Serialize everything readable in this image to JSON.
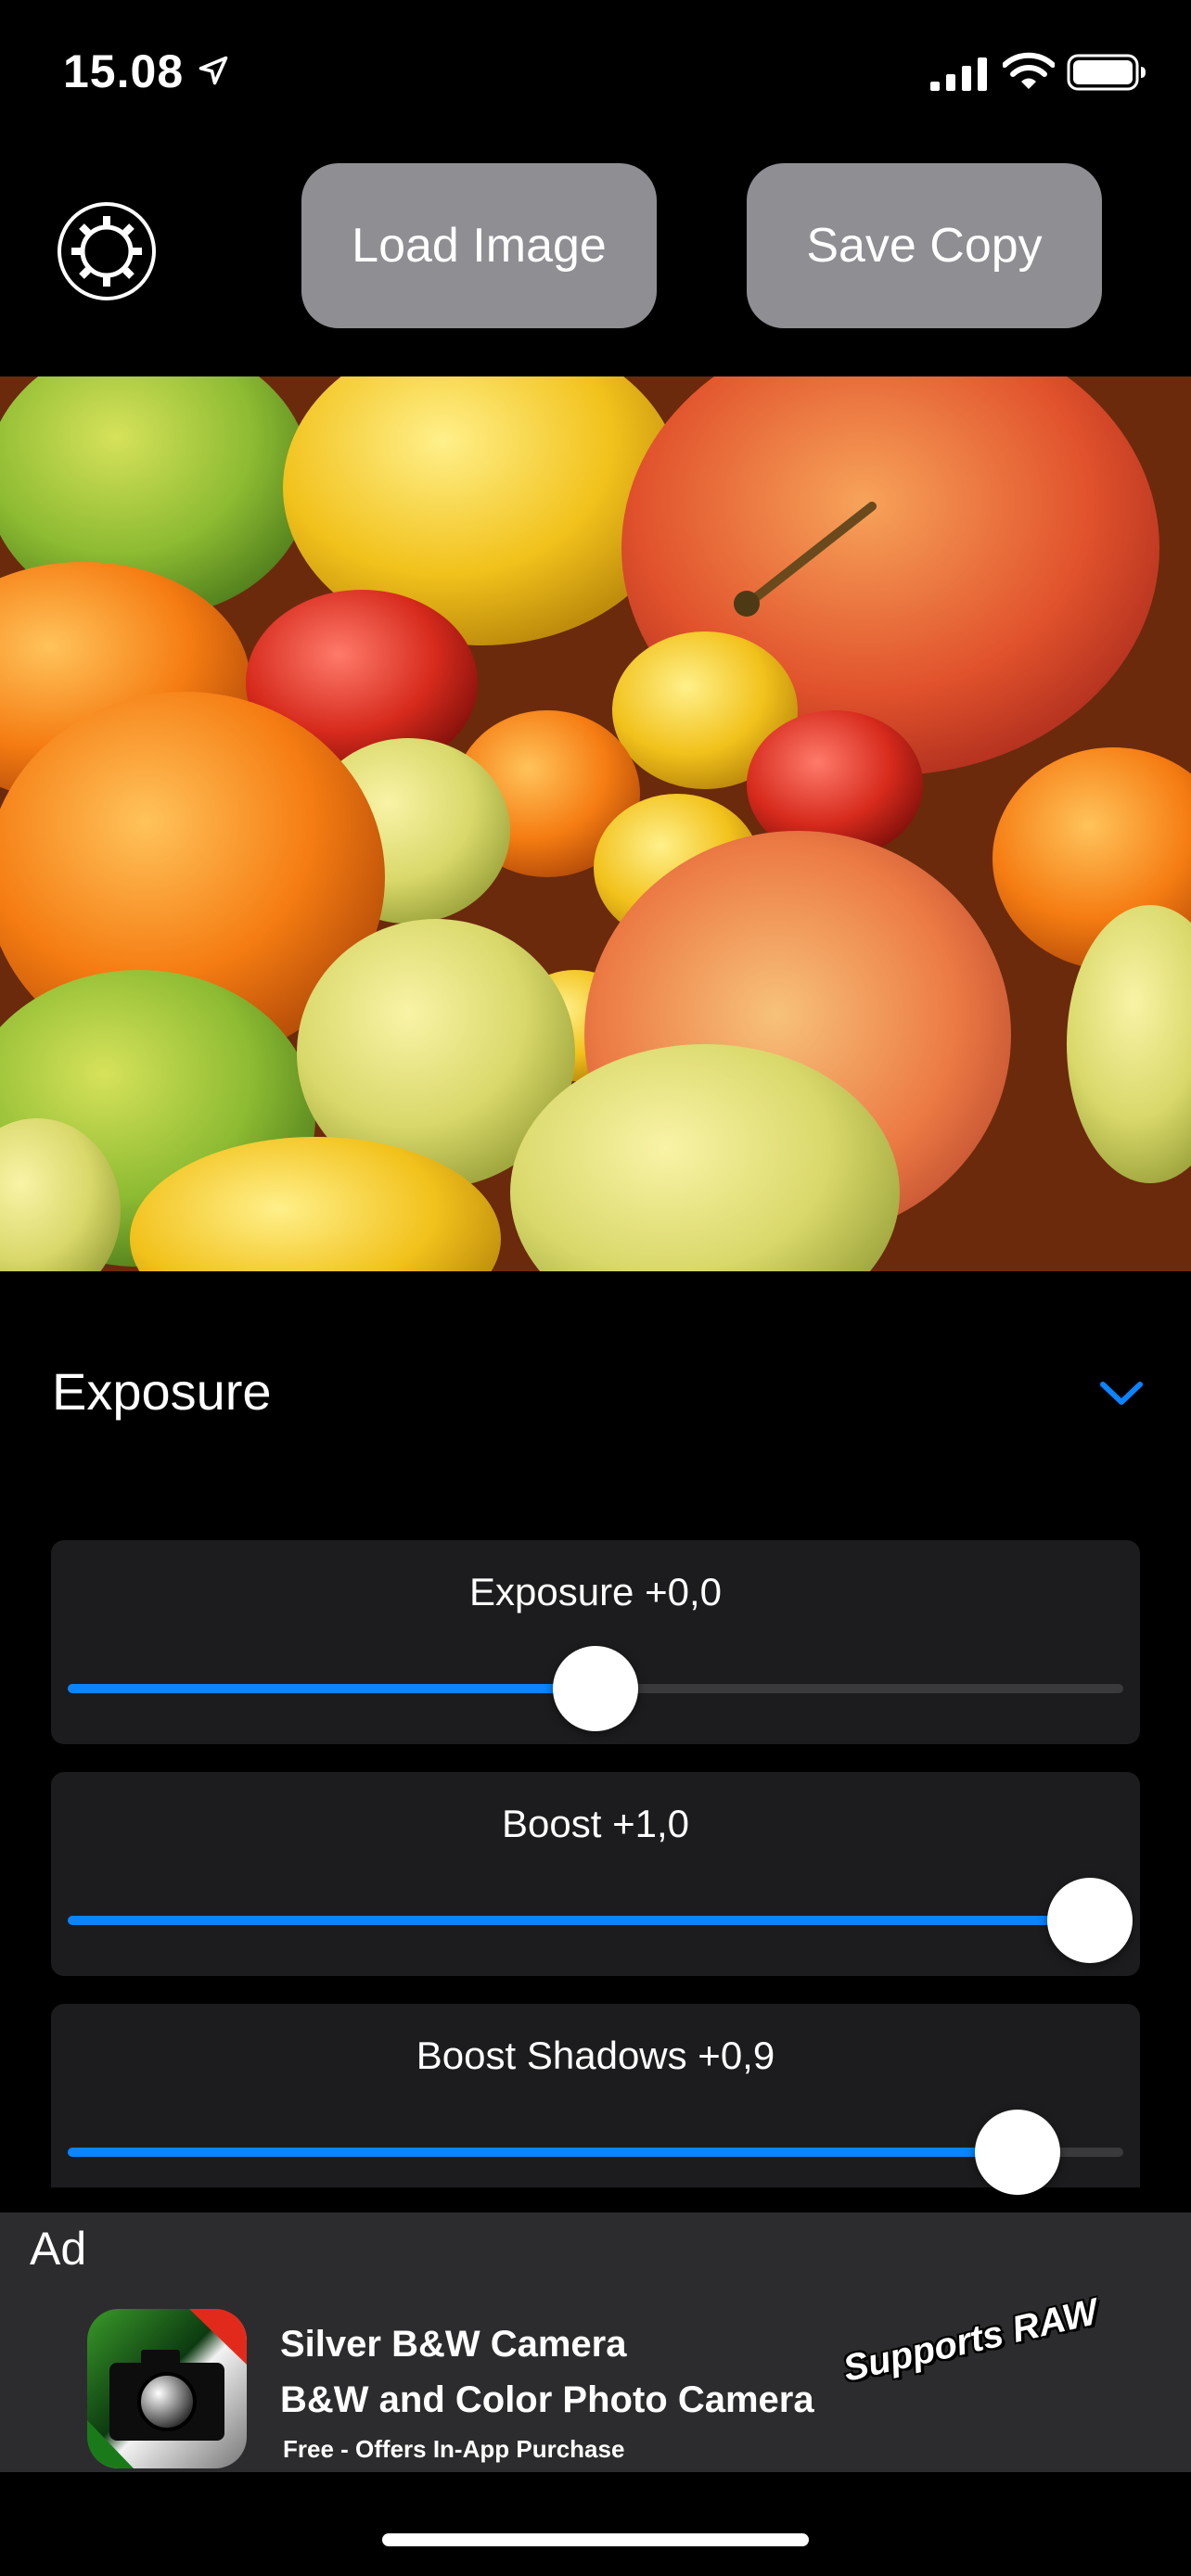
{
  "status_bar": {
    "time": "15.08",
    "icons": [
      "location-arrow-icon",
      "cellular-signal-icon",
      "wifi-icon",
      "battery-icon"
    ]
  },
  "toolbar": {
    "settings_icon": "gear-icon",
    "load_label": "Load Image",
    "save_label": "Save Copy"
  },
  "photo": {
    "alt": "tomatoes-and-apples-photo"
  },
  "section": {
    "title": "Exposure",
    "chevron_icon": "chevron-down-icon",
    "accent": "#0a84ff"
  },
  "sliders": [
    {
      "label": "Exposure +0,0",
      "value": 0.5
    },
    {
      "label": "Boost +1,0",
      "value": 1.0
    },
    {
      "label": "Boost Shadows +0,9",
      "value": 0.9
    }
  ],
  "ad": {
    "label": "Ad",
    "title": "Silver B&W Camera",
    "subtitle": "B&W and Color Photo Camera",
    "note": "Free - Offers In-App Purchase",
    "badge": "Supports RAW"
  }
}
